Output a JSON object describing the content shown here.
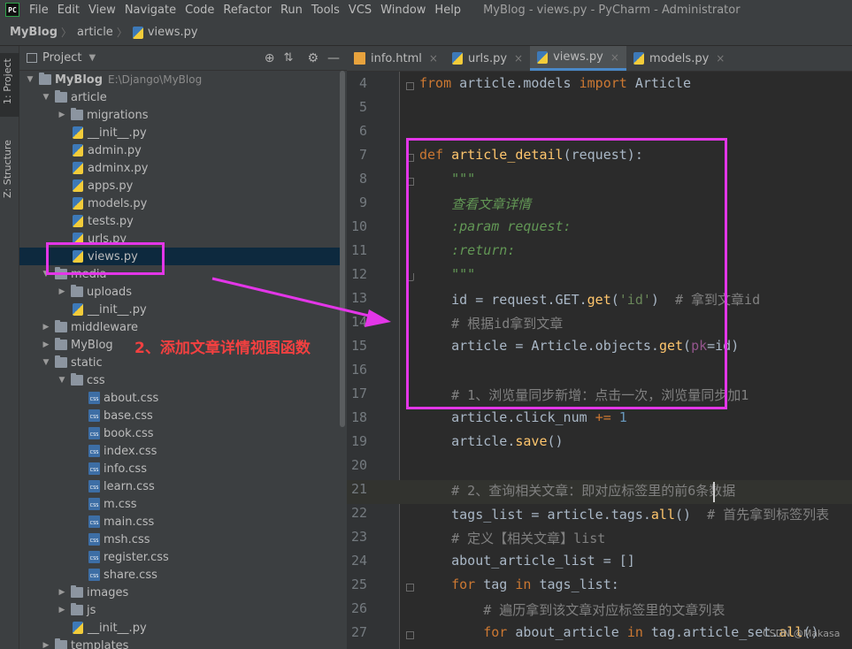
{
  "menubar": {
    "logo": "PC",
    "items": [
      "File",
      "Edit",
      "View",
      "Navigate",
      "Code",
      "Refactor",
      "Run",
      "Tools",
      "VCS",
      "Window",
      "Help"
    ],
    "title": "MyBlog - views.py - PyCharm - Administrator"
  },
  "breadcrumb": [
    "MyBlog",
    "article",
    "views.py"
  ],
  "left_strip": {
    "tab_project": "1: Project",
    "tab_structure": "Z: Structure"
  },
  "project_panel": {
    "title": "Project",
    "root": "MyBlog",
    "root_path": "E:\\Django\\MyBlog",
    "tree": [
      {
        "label": "MyBlog",
        "type": "folder",
        "level": 0,
        "expanded": true,
        "bold": true
      },
      {
        "label": "article",
        "type": "folder",
        "level": 1,
        "expanded": true
      },
      {
        "label": "migrations",
        "type": "folder",
        "level": 2,
        "expanded": false
      },
      {
        "label": "__init__.py",
        "type": "py",
        "level": 2
      },
      {
        "label": "admin.py",
        "type": "py",
        "level": 2
      },
      {
        "label": "adminx.py",
        "type": "py",
        "level": 2
      },
      {
        "label": "apps.py",
        "type": "py",
        "level": 2
      },
      {
        "label": "models.py",
        "type": "py",
        "level": 2
      },
      {
        "label": "tests.py",
        "type": "py",
        "level": 2
      },
      {
        "label": "urls.py",
        "type": "py",
        "level": 2
      },
      {
        "label": "views.py",
        "type": "py",
        "level": 2,
        "selected": true
      },
      {
        "label": "media",
        "type": "folder",
        "level": 1,
        "expanded": true
      },
      {
        "label": "uploads",
        "type": "folder",
        "level": 2,
        "expanded": false
      },
      {
        "label": "__init__.py",
        "type": "py",
        "level": 2
      },
      {
        "label": "middleware",
        "type": "folder",
        "level": 1,
        "expanded": false
      },
      {
        "label": "MyBlog",
        "type": "folder",
        "level": 1,
        "expanded": false
      },
      {
        "label": "static",
        "type": "folder",
        "level": 1,
        "expanded": true
      },
      {
        "label": "css",
        "type": "folder",
        "level": 2,
        "expanded": true
      },
      {
        "label": "about.css",
        "type": "css",
        "level": 3
      },
      {
        "label": "base.css",
        "type": "css",
        "level": 3
      },
      {
        "label": "book.css",
        "type": "css",
        "level": 3
      },
      {
        "label": "index.css",
        "type": "css",
        "level": 3
      },
      {
        "label": "info.css",
        "type": "css",
        "level": 3
      },
      {
        "label": "learn.css",
        "type": "css",
        "level": 3
      },
      {
        "label": "m.css",
        "type": "css",
        "level": 3
      },
      {
        "label": "main.css",
        "type": "css",
        "level": 3
      },
      {
        "label": "msh.css",
        "type": "css",
        "level": 3
      },
      {
        "label": "register.css",
        "type": "css",
        "level": 3
      },
      {
        "label": "share.css",
        "type": "css",
        "level": 3
      },
      {
        "label": "images",
        "type": "folder",
        "level": 2,
        "expanded": false
      },
      {
        "label": "js",
        "type": "folder",
        "level": 2,
        "expanded": false
      },
      {
        "label": "__init__.py",
        "type": "py",
        "level": 2
      },
      {
        "label": "templates",
        "type": "folder",
        "level": 1,
        "expanded": false
      }
    ]
  },
  "tabs": [
    {
      "label": "info.html",
      "icon": "html-file-icon",
      "active": false
    },
    {
      "label": "urls.py",
      "icon": "python-file-icon",
      "active": false
    },
    {
      "label": "views.py",
      "icon": "python-file-icon",
      "active": true
    },
    {
      "label": "models.py",
      "icon": "python-file-icon",
      "active": false
    }
  ],
  "tab_close": "×",
  "editor": {
    "current_line": 21,
    "lines": [
      {
        "n": "4",
        "html": "<span class='kw'>from</span> article.models <span class='kw'>import</span> Article"
      },
      {
        "n": "5",
        "html": ""
      },
      {
        "n": "6",
        "html": ""
      },
      {
        "n": "7",
        "html": "<span class='kw'>def</span> <span class='fn'>article_detail</span>(request):"
      },
      {
        "n": "8",
        "html": "    <span class='cn'>\"\"\"</span>"
      },
      {
        "n": "9",
        "html": "    <span class='cn'>查看文章详情</span>"
      },
      {
        "n": "10",
        "html": "    <span class='cn'>:param request:</span>"
      },
      {
        "n": "11",
        "html": "    <span class='cn'>:return:</span>"
      },
      {
        "n": "12",
        "html": "    <span class='cn'>\"\"\"</span>"
      },
      {
        "n": "13",
        "html": "    id = request.GET.<span class='fn'>get</span>(<span class='str'>'id'</span>)  <span class='cm'># 拿到文章id</span>"
      },
      {
        "n": "14",
        "html": "    <span class='cm'># 根据id拿到文章</span>"
      },
      {
        "n": "15",
        "html": "    article = Article.objects.<span class='fn'>get</span>(<span class='par'>pk</span>=id)"
      },
      {
        "n": "16",
        "html": ""
      },
      {
        "n": "17",
        "html": "    <span class='cm'># 1、浏览量同步新增：点击一次，浏览量同步加1</span>"
      },
      {
        "n": "18",
        "html": "    article.click_num <span class='kw'>+=</span> <span class='num'>1</span>"
      },
      {
        "n": "19",
        "html": "    article.<span class='fn'>save</span>()"
      },
      {
        "n": "20",
        "html": ""
      },
      {
        "n": "21",
        "html": "    <span class='cm'># 2、查询相关文章：即对应标签里的前6条数据</span>"
      },
      {
        "n": "22",
        "html": "    tags_list = article.tags.<span class='fn'>all</span>()  <span class='cm'># 首先拿到标签列表</span>"
      },
      {
        "n": "23",
        "html": "    <span class='cm'># 定义【相关文章】list</span>"
      },
      {
        "n": "24",
        "html": "    about_article_list = []"
      },
      {
        "n": "25",
        "html": "    <span class='kw'>for</span> tag <span class='kw'>in</span> tags_list:"
      },
      {
        "n": "26",
        "html": "        <span class='cm'># 遍历拿到该文章对应标签里的文章列表</span>"
      },
      {
        "n": "27",
        "html": "        <span class='kw'>for</span> about_article <span class='kw'>in</span> tag.article_set.<span class='fn'>all</span>()"
      }
    ]
  },
  "annotation": {
    "text": "2、添加文章详情视图函数",
    "color": "#e336e8",
    "text_color": "#f24040"
  },
  "watermark": "CSDN @Makasa"
}
